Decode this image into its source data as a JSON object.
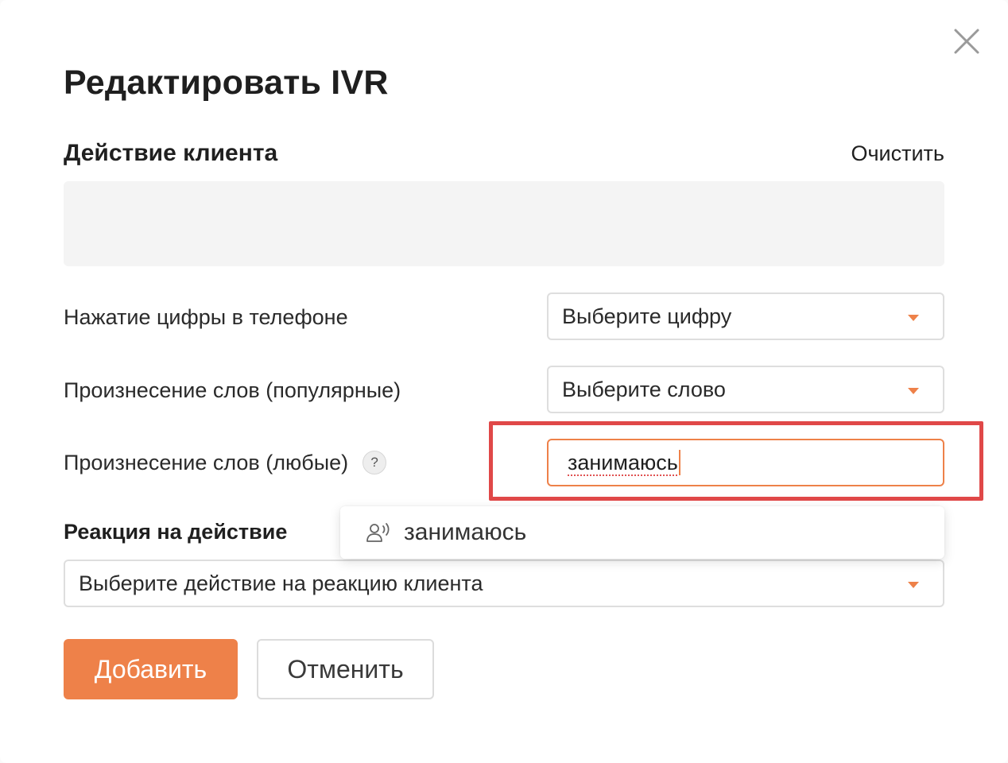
{
  "dialog": {
    "title": "Редактировать IVR"
  },
  "client_action": {
    "heading": "Действие клиента",
    "clear_label": "Очистить"
  },
  "digit_press": {
    "label": "Нажатие цифры в телефоне",
    "select_value": "Выберите цифру"
  },
  "popular_words": {
    "label": "Произнесение слов (популярные)",
    "select_value": "Выберите слово"
  },
  "any_words": {
    "label": "Произнесение слов (любые)",
    "help_glyph": "?",
    "input_value": "занимаюсь"
  },
  "suggestion": {
    "icon": "voice-person-icon",
    "text": "занимаюсь"
  },
  "reaction": {
    "heading": "Реакция на действие",
    "select_value": "Выберите действие на реакцию клиента"
  },
  "buttons": {
    "add_label": "Добавить",
    "cancel_label": "Отменить"
  },
  "colors": {
    "accent": "#ee8149",
    "highlight": "#e04848",
    "field_bg": "#f4f4f4"
  }
}
